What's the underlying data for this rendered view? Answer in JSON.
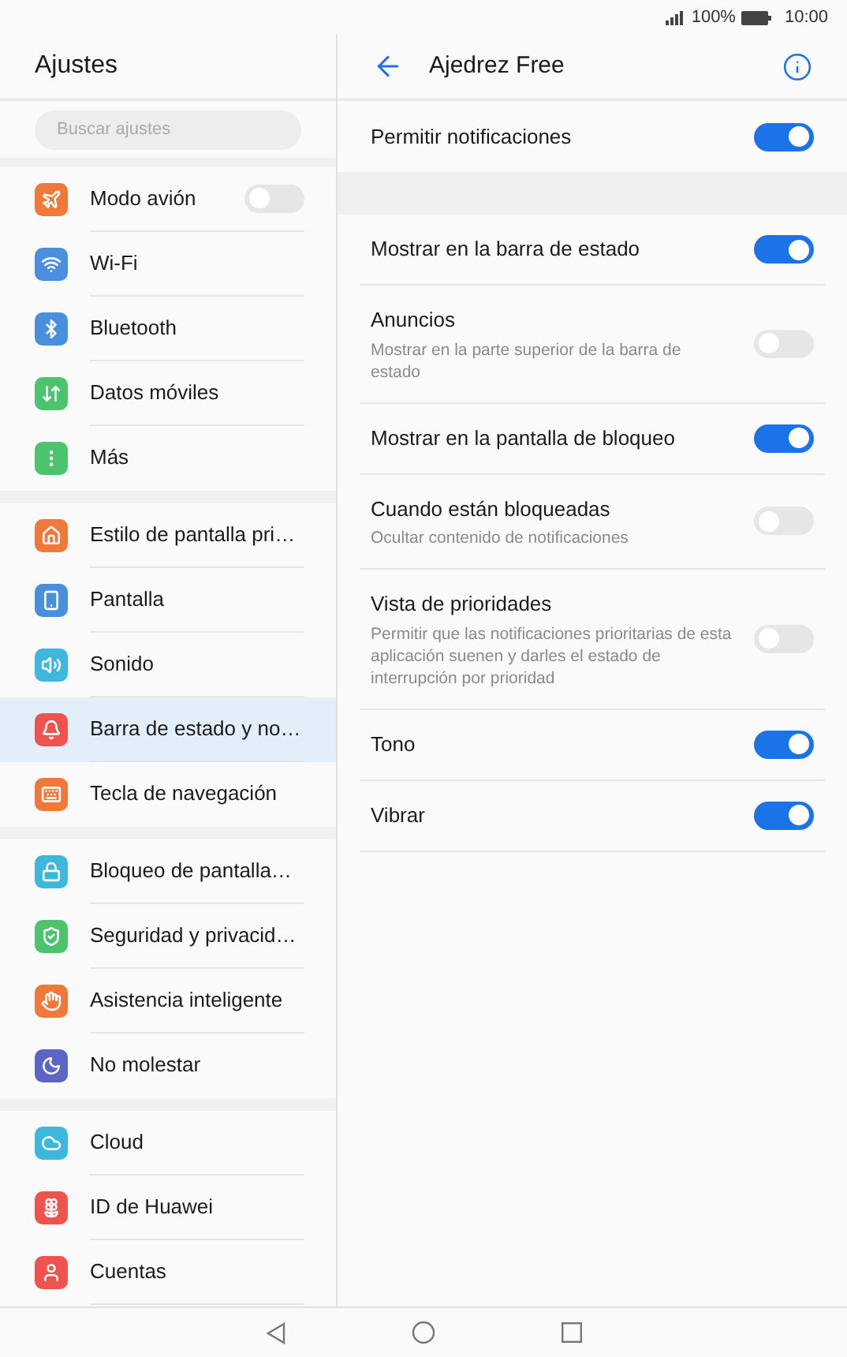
{
  "status_bar": {
    "battery": "100%",
    "time": "10:00"
  },
  "sidebar": {
    "title": "Ajustes",
    "search": {
      "placeholder": "Buscar ajustes"
    },
    "groups": [
      {
        "items": [
          {
            "label": "Modo avión",
            "color": "#f0793a",
            "selected": false,
            "kind": "toggle",
            "on": false
          },
          {
            "label": "Wi-Fi",
            "color": "#4a8fde",
            "selected": false,
            "kind": "link"
          },
          {
            "label": "Bluetooth",
            "color": "#4a8fde",
            "selected": false,
            "kind": "link"
          },
          {
            "label": "Datos móviles",
            "color": "#4cc46e",
            "selected": false,
            "kind": "link"
          },
          {
            "label": "Más",
            "color": "#4cc46e",
            "selected": false,
            "kind": "link"
          }
        ]
      },
      {
        "items": [
          {
            "label": "Estilo de pantalla pri…",
            "color": "#f0793a",
            "selected": false,
            "kind": "link"
          },
          {
            "label": "Pantalla",
            "color": "#4a8fde",
            "selected": false,
            "kind": "link"
          },
          {
            "label": "Sonido",
            "color": "#3db8dc",
            "selected": false,
            "kind": "link"
          },
          {
            "label": "Barra de estado y no…",
            "color": "#f0524e",
            "selected": true,
            "kind": "link"
          },
          {
            "label": "Tecla de navegación",
            "color": "#f0793a",
            "selected": false,
            "kind": "link"
          }
        ]
      },
      {
        "items": [
          {
            "label": "Bloqueo de pantalla…",
            "color": "#3db8dc",
            "selected": false,
            "kind": "link"
          },
          {
            "label": "Seguridad y privacid…",
            "color": "#4cc46e",
            "selected": false,
            "kind": "link"
          },
          {
            "label": "Asistencia inteligente",
            "color": "#f0793a",
            "selected": false,
            "kind": "link"
          },
          {
            "label": "No molestar",
            "color": "#5b66c4",
            "selected": false,
            "kind": "link"
          }
        ]
      },
      {
        "items": [
          {
            "label": "Cloud",
            "color": "#3db8dc",
            "selected": false,
            "kind": "link"
          },
          {
            "label": "ID de Huawei",
            "color": "#f0524e",
            "selected": false,
            "kind": "link"
          },
          {
            "label": "Cuentas",
            "color": "#f0524e",
            "selected": false,
            "kind": "link"
          }
        ]
      }
    ]
  },
  "detail": {
    "title": "Ajedrez Free",
    "sections": [
      {
        "items": [
          {
            "title": "Permitir notificaciones",
            "on": true
          }
        ]
      },
      {
        "items": [
          {
            "title": "Mostrar en la barra de estado",
            "on": true
          },
          {
            "title": "Anuncios",
            "description": "Mostrar en la parte superior de la barra de estado",
            "on": false
          },
          {
            "title": "Mostrar en la pantalla de bloqueo",
            "on": true
          },
          {
            "title": "Cuando están bloqueadas",
            "description": "Ocultar contenido de notificaciones",
            "on": false
          },
          {
            "title": "Vista de prioridades",
            "description": "Permitir que las notificaciones prioritarias de esta aplicación suenen y darles el estado de interrupción por prioridad",
            "on": false
          },
          {
            "title": "Tono",
            "on": true
          },
          {
            "title": "Vibrar",
            "on": true
          }
        ]
      }
    ]
  }
}
